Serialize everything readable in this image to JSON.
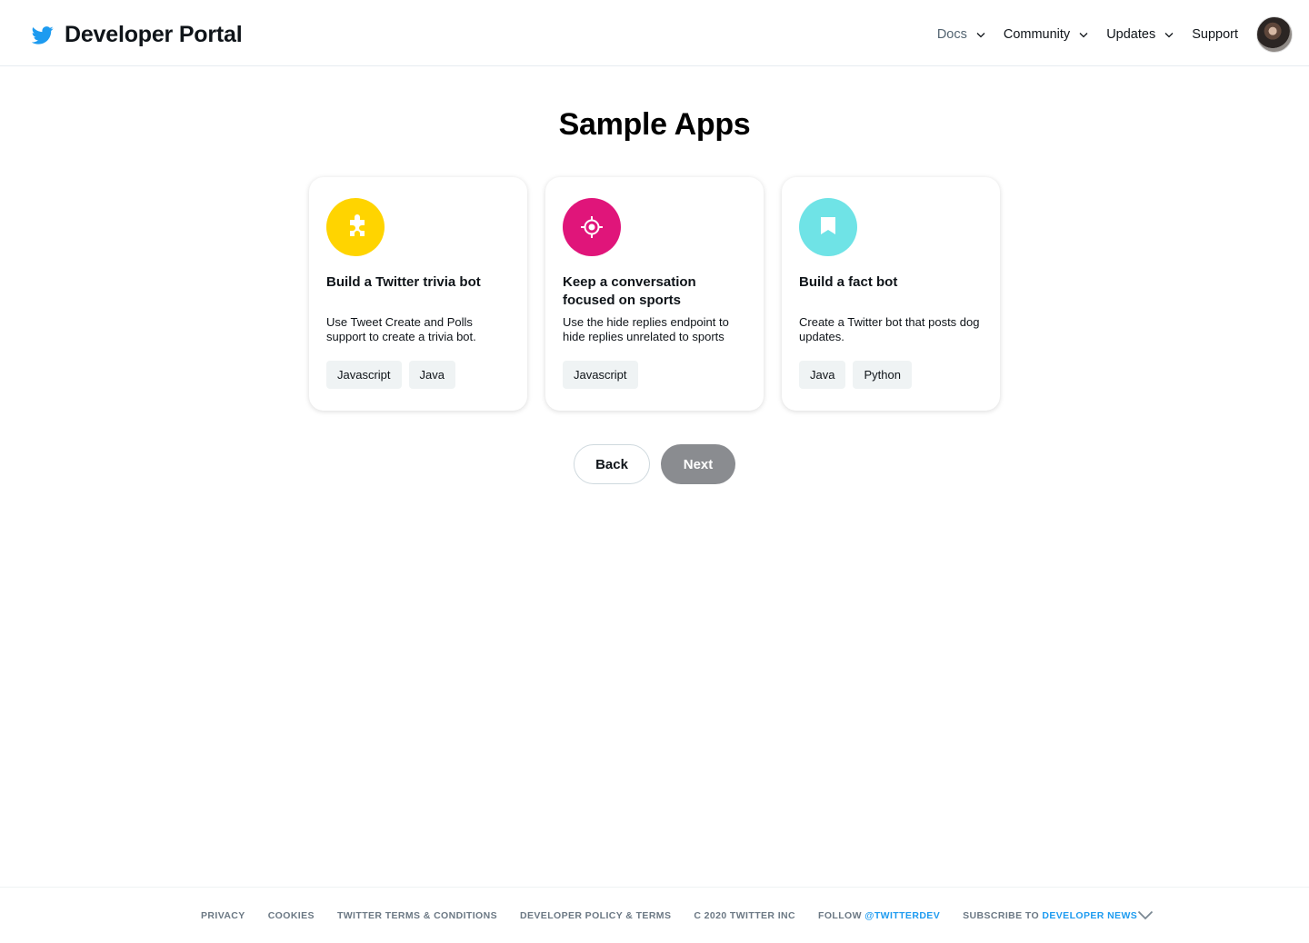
{
  "header": {
    "brand_title": "Developer Portal",
    "brand_color": "#1d9bf0",
    "nav": [
      {
        "label": "Docs",
        "has_dropdown": true
      },
      {
        "label": "Community",
        "has_dropdown": true
      },
      {
        "label": "Updates",
        "has_dropdown": true
      },
      {
        "label": "Support",
        "has_dropdown": false
      }
    ]
  },
  "main": {
    "title": "Sample Apps",
    "cards": [
      {
        "icon": "puzzle-piece-icon",
        "icon_color": "#ffd400",
        "title": "Build a Twitter trivia bot",
        "description": "Use Tweet Create and Polls support to create a trivia bot.",
        "tags": [
          "Javascript",
          "Java"
        ]
      },
      {
        "icon": "target-icon",
        "icon_color": "#e0157a",
        "title": "Keep a conversation focused on sports",
        "description": "Use the hide replies endpoint to hide replies unrelated to sports",
        "tags": [
          "Javascript"
        ]
      },
      {
        "icon": "bookmark-icon",
        "icon_color": "#6fe3e6",
        "title": "Build a fact bot",
        "description": "Create a Twitter bot that posts dog updates.",
        "tags": [
          "Java",
          "Python"
        ]
      }
    ],
    "back_label": "Back",
    "next_label": "Next"
  },
  "footer": {
    "links": [
      {
        "text": "PRIVACY"
      },
      {
        "text": "COOKIES"
      },
      {
        "text": "TWITTER TERMS & CONDITIONS"
      },
      {
        "text": "DEVELOPER POLICY & TERMS"
      },
      {
        "text": "C 2020 TWITTER INC"
      },
      {
        "text": "FOLLOW ",
        "accent": "@TWITTERDEV"
      },
      {
        "text": "SUBSCRIBE TO ",
        "accent": "DEVELOPER NEWS"
      }
    ],
    "accent_color": "#1d9bf0"
  }
}
